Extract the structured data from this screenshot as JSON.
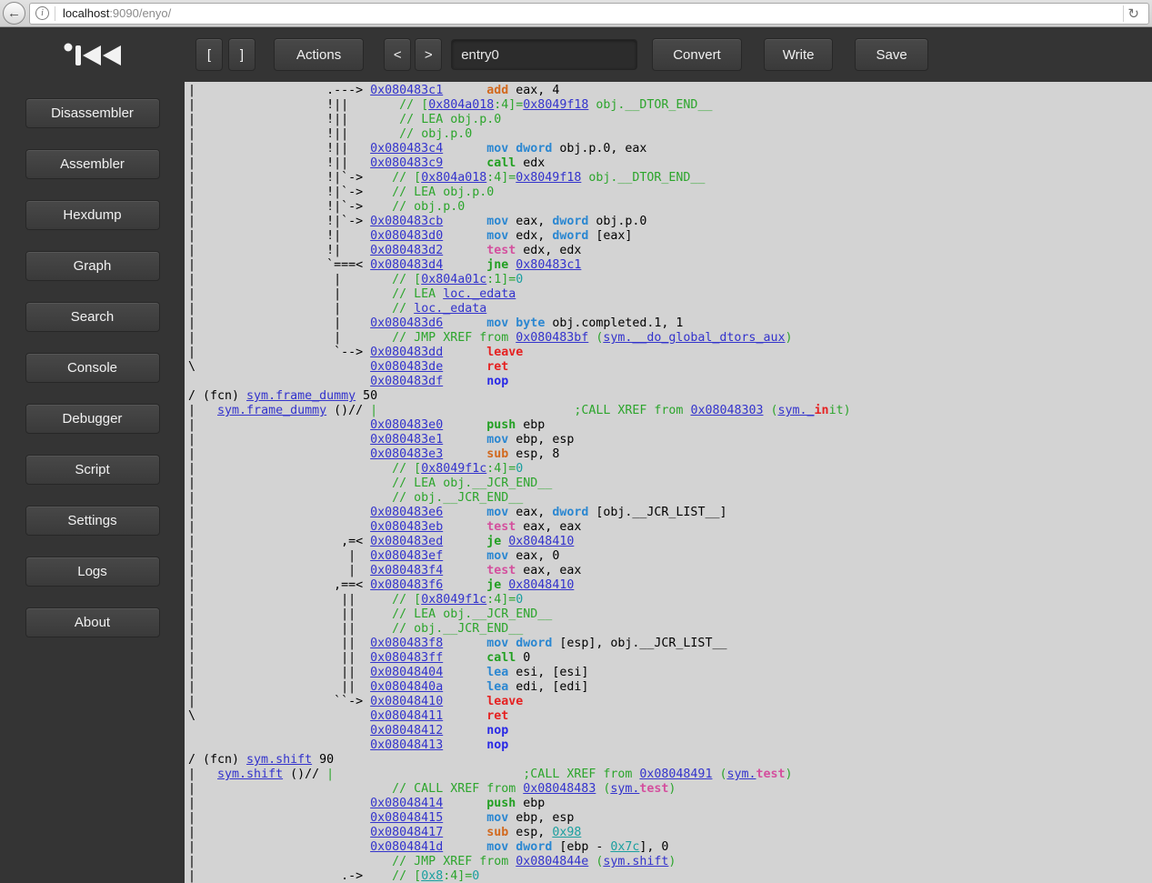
{
  "browser": {
    "back_icon": "←",
    "info_icon": "i",
    "url_host": "localhost",
    "url_rest": ":9090/enyo/",
    "reload_icon": "↻"
  },
  "sidebar": {
    "items": [
      "Disassembler",
      "Assembler",
      "Hexdump",
      "Graph",
      "Search",
      "Console",
      "Debugger",
      "Script",
      "Settings",
      "Logs",
      "About"
    ]
  },
  "toolbar": {
    "bracket_open": "[",
    "bracket_close": "]",
    "actions": "Actions",
    "prev": "<",
    "next": ">",
    "seek_value": "entry0",
    "convert": "Convert",
    "write": "Write",
    "save": "Save"
  },
  "colors": {
    "address_link": "#3333cc",
    "comment": "#2ca52c",
    "opcode_mov": "#2b87d1",
    "opcode_call": "#22a022",
    "opcode_math": "#d2691e",
    "opcode_test": "#d4509e",
    "opcode_ret": "#e52222",
    "opcode_nop": "#2929e6",
    "number": "#1a9f9f",
    "panel_dark": "#343434",
    "content_bg": "#d3d3d3"
  },
  "disasm": {
    "lines": [
      [
        [
          "f",
          "|                  .---> "
        ],
        [
          "a",
          "0x080483c1"
        ],
        [
          "f",
          "      "
        ],
        [
          "ko",
          "add"
        ],
        [
          "f",
          " eax, 4"
        ]
      ],
      [
        [
          "f",
          "|                  !||       "
        ],
        [
          "c",
          "// ["
        ],
        [
          "a",
          "0x804a018"
        ],
        [
          "c",
          ":4]="
        ],
        [
          "a",
          "0x8049f18"
        ],
        [
          "c",
          " obj.__DTOR_END__"
        ]
      ],
      [
        [
          "f",
          "|                  !||       "
        ],
        [
          "c",
          "// LEA obj.p.0"
        ]
      ],
      [
        [
          "f",
          "|                  !||       "
        ],
        [
          "c",
          "// obj.p.0"
        ]
      ],
      [
        [
          "f",
          "|                  !||   "
        ],
        [
          "a",
          "0x080483c4"
        ],
        [
          "f",
          "      "
        ],
        [
          "kb",
          "mov"
        ],
        [
          "f",
          " "
        ],
        [
          "kb",
          "dword"
        ],
        [
          "f",
          " obj.p.0, eax"
        ]
      ],
      [
        [
          "f",
          "|                  !||   "
        ],
        [
          "a",
          "0x080483c9"
        ],
        [
          "f",
          "      "
        ],
        [
          "kg",
          "call"
        ],
        [
          "f",
          " edx"
        ]
      ],
      [
        [
          "f",
          "|                  !|`->    "
        ],
        [
          "c",
          "// ["
        ],
        [
          "a",
          "0x804a018"
        ],
        [
          "c",
          ":4]="
        ],
        [
          "a",
          "0x8049f18"
        ],
        [
          "c",
          " obj.__DTOR_END__"
        ]
      ],
      [
        [
          "f",
          "|                  !|`->    "
        ],
        [
          "c",
          "// LEA obj.p.0"
        ]
      ],
      [
        [
          "f",
          "|                  !|`->    "
        ],
        [
          "c",
          "// obj.p.0"
        ]
      ],
      [
        [
          "f",
          "|                  !|`-> "
        ],
        [
          "a",
          "0x080483cb"
        ],
        [
          "f",
          "      "
        ],
        [
          "kb",
          "mov"
        ],
        [
          "f",
          " eax, "
        ],
        [
          "kb",
          "dword"
        ],
        [
          "f",
          " obj.p.0"
        ]
      ],
      [
        [
          "f",
          "|                  !|    "
        ],
        [
          "a",
          "0x080483d0"
        ],
        [
          "f",
          "      "
        ],
        [
          "kb",
          "mov"
        ],
        [
          "f",
          " edx, "
        ],
        [
          "kb",
          "dword"
        ],
        [
          "f",
          " [eax]"
        ]
      ],
      [
        [
          "f",
          "|                  !|    "
        ],
        [
          "a",
          "0x080483d2"
        ],
        [
          "f",
          "      "
        ],
        [
          "kp",
          "test"
        ],
        [
          "f",
          " edx, edx"
        ]
      ],
      [
        [
          "f",
          "|                  `===< "
        ],
        [
          "a",
          "0x080483d4"
        ],
        [
          "f",
          "      "
        ],
        [
          "kg",
          "jne"
        ],
        [
          "f",
          " "
        ],
        [
          "a",
          "0x80483c1"
        ]
      ],
      [
        [
          "f",
          "|                   |       "
        ],
        [
          "c",
          "// ["
        ],
        [
          "a",
          "0x804a01c"
        ],
        [
          "c",
          ":1]="
        ],
        [
          "t",
          "0"
        ]
      ],
      [
        [
          "f",
          "|                   |       "
        ],
        [
          "c",
          "// LEA "
        ],
        [
          "a",
          "loc._edata"
        ]
      ],
      [
        [
          "f",
          "|                   |       "
        ],
        [
          "c",
          "// "
        ],
        [
          "a",
          "loc._edata"
        ]
      ],
      [
        [
          "f",
          "|                   |    "
        ],
        [
          "a",
          "0x080483d6"
        ],
        [
          "f",
          "      "
        ],
        [
          "kb",
          "mov"
        ],
        [
          "f",
          " "
        ],
        [
          "kb",
          "byte"
        ],
        [
          "f",
          " obj.completed.1, 1"
        ]
      ],
      [
        [
          "f",
          "|                   |       "
        ],
        [
          "c",
          "// JMP XREF from "
        ],
        [
          "a",
          "0x080483bf"
        ],
        [
          "c",
          " ("
        ],
        [
          "a",
          "sym.__do_global_dtors_aux"
        ],
        [
          "c",
          ")"
        ]
      ],
      [
        [
          "f",
          "|                   `--> "
        ],
        [
          "a",
          "0x080483dd"
        ],
        [
          "f",
          "      "
        ],
        [
          "kr",
          "leave"
        ]
      ],
      [
        [
          "f",
          "\\                        "
        ],
        [
          "a",
          "0x080483de"
        ],
        [
          "f",
          "      "
        ],
        [
          "kr",
          "ret"
        ]
      ],
      [
        [
          "f",
          "                         "
        ],
        [
          "a",
          "0x080483df"
        ],
        [
          "f",
          "      "
        ],
        [
          "kn",
          "nop"
        ]
      ],
      [
        [
          "f",
          "/ (fcn) "
        ],
        [
          "a",
          "sym.frame_dummy"
        ],
        [
          "f",
          " 50"
        ]
      ],
      [
        [
          "f",
          "|   "
        ],
        [
          "a",
          "sym.frame_dummy"
        ],
        [
          "f",
          " ()// "
        ],
        [
          "c",
          "|"
        ],
        [
          "f",
          "                           "
        ],
        [
          "c",
          ";CALL XREF from "
        ],
        [
          "a",
          "0x08048303"
        ],
        [
          "c",
          " ("
        ],
        [
          "a",
          "sym._"
        ],
        [
          "hr",
          "in"
        ],
        [
          "c",
          "it)"
        ]
      ],
      [
        [
          "f",
          "|                        "
        ],
        [
          "a",
          "0x080483e0"
        ],
        [
          "f",
          "      "
        ],
        [
          "kg",
          "push"
        ],
        [
          "f",
          " ebp"
        ]
      ],
      [
        [
          "f",
          "|                        "
        ],
        [
          "a",
          "0x080483e1"
        ],
        [
          "f",
          "      "
        ],
        [
          "kb",
          "mov"
        ],
        [
          "f",
          " ebp, esp"
        ]
      ],
      [
        [
          "f",
          "|                        "
        ],
        [
          "a",
          "0x080483e3"
        ],
        [
          "f",
          "      "
        ],
        [
          "ko",
          "sub"
        ],
        [
          "f",
          " esp, 8"
        ]
      ],
      [
        [
          "f",
          "|                           "
        ],
        [
          "c",
          "// ["
        ],
        [
          "a",
          "0x8049f1c"
        ],
        [
          "c",
          ":4]="
        ],
        [
          "t",
          "0"
        ]
      ],
      [
        [
          "f",
          "|                           "
        ],
        [
          "c",
          "// LEA obj.__JCR_END__"
        ]
      ],
      [
        [
          "f",
          "|                           "
        ],
        [
          "c",
          "// obj.__JCR_END__"
        ]
      ],
      [
        [
          "f",
          "|                        "
        ],
        [
          "a",
          "0x080483e6"
        ],
        [
          "f",
          "      "
        ],
        [
          "kb",
          "mov"
        ],
        [
          "f",
          " eax, "
        ],
        [
          "kb",
          "dword"
        ],
        [
          "f",
          " [obj.__JCR_LIST__]"
        ]
      ],
      [
        [
          "f",
          "|                        "
        ],
        [
          "a",
          "0x080483eb"
        ],
        [
          "f",
          "      "
        ],
        [
          "kp",
          "test"
        ],
        [
          "f",
          " eax, eax"
        ]
      ],
      [
        [
          "f",
          "|                    ,=< "
        ],
        [
          "a",
          "0x080483ed"
        ],
        [
          "f",
          "      "
        ],
        [
          "kg",
          "je"
        ],
        [
          "f",
          " "
        ],
        [
          "a",
          "0x8048410"
        ]
      ],
      [
        [
          "f",
          "|                     |  "
        ],
        [
          "a",
          "0x080483ef"
        ],
        [
          "f",
          "      "
        ],
        [
          "kb",
          "mov"
        ],
        [
          "f",
          " eax, 0"
        ]
      ],
      [
        [
          "f",
          "|                     |  "
        ],
        [
          "a",
          "0x080483f4"
        ],
        [
          "f",
          "      "
        ],
        [
          "kp",
          "test"
        ],
        [
          "f",
          " eax, eax"
        ]
      ],
      [
        [
          "f",
          "|                   ,==< "
        ],
        [
          "a",
          "0x080483f6"
        ],
        [
          "f",
          "      "
        ],
        [
          "kg",
          "je"
        ],
        [
          "f",
          " "
        ],
        [
          "a",
          "0x8048410"
        ]
      ],
      [
        [
          "f",
          "|                    ||     "
        ],
        [
          "c",
          "// ["
        ],
        [
          "a",
          "0x8049f1c"
        ],
        [
          "c",
          ":4]="
        ],
        [
          "t",
          "0"
        ]
      ],
      [
        [
          "f",
          "|                    ||     "
        ],
        [
          "c",
          "// LEA obj.__JCR_END__"
        ]
      ],
      [
        [
          "f",
          "|                    ||     "
        ],
        [
          "c",
          "// obj.__JCR_END__"
        ]
      ],
      [
        [
          "f",
          "|                    ||  "
        ],
        [
          "a",
          "0x080483f8"
        ],
        [
          "f",
          "      "
        ],
        [
          "kb",
          "mov"
        ],
        [
          "f",
          " "
        ],
        [
          "kb",
          "dword"
        ],
        [
          "f",
          " [esp], obj.__JCR_LIST__"
        ]
      ],
      [
        [
          "f",
          "|                    ||  "
        ],
        [
          "a",
          "0x080483ff"
        ],
        [
          "f",
          "      "
        ],
        [
          "kg",
          "call"
        ],
        [
          "f",
          " 0"
        ]
      ],
      [
        [
          "f",
          "|                    ||  "
        ],
        [
          "a",
          "0x08048404"
        ],
        [
          "f",
          "      "
        ],
        [
          "kb",
          "lea"
        ],
        [
          "f",
          " esi, [esi]"
        ]
      ],
      [
        [
          "f",
          "|                    ||  "
        ],
        [
          "a",
          "0x0804840a"
        ],
        [
          "f",
          "      "
        ],
        [
          "kb",
          "lea"
        ],
        [
          "f",
          " edi, [edi]"
        ]
      ],
      [
        [
          "f",
          "|                   ``-> "
        ],
        [
          "a",
          "0x08048410"
        ],
        [
          "f",
          "      "
        ],
        [
          "kr",
          "leave"
        ]
      ],
      [
        [
          "f",
          "\\                        "
        ],
        [
          "a",
          "0x08048411"
        ],
        [
          "f",
          "      "
        ],
        [
          "kr",
          "ret"
        ]
      ],
      [
        [
          "f",
          "                         "
        ],
        [
          "a",
          "0x08048412"
        ],
        [
          "f",
          "      "
        ],
        [
          "kn",
          "nop"
        ]
      ],
      [
        [
          "f",
          "                         "
        ],
        [
          "a",
          "0x08048413"
        ],
        [
          "f",
          "      "
        ],
        [
          "kn",
          "nop"
        ]
      ],
      [
        [
          "f",
          "/ (fcn) "
        ],
        [
          "a",
          "sym.shift"
        ],
        [
          "f",
          " 90"
        ]
      ],
      [
        [
          "f",
          "|   "
        ],
        [
          "a",
          "sym.shift"
        ],
        [
          "f",
          " ()// "
        ],
        [
          "c",
          "|"
        ],
        [
          "f",
          "                          "
        ],
        [
          "c",
          ";CALL XREF from "
        ],
        [
          "a",
          "0x08048491"
        ],
        [
          "c",
          " ("
        ],
        [
          "a",
          "sym."
        ],
        [
          "kp",
          "test"
        ],
        [
          "c",
          ")"
        ]
      ],
      [
        [
          "f",
          "|                           "
        ],
        [
          "c",
          "// CALL XREF from "
        ],
        [
          "a",
          "0x08048483"
        ],
        [
          "c",
          " ("
        ],
        [
          "a",
          "sym."
        ],
        [
          "kp",
          "test"
        ],
        [
          "c",
          ")"
        ]
      ],
      [
        [
          "f",
          "|                        "
        ],
        [
          "a",
          "0x08048414"
        ],
        [
          "f",
          "      "
        ],
        [
          "kg",
          "push"
        ],
        [
          "f",
          " ebp"
        ]
      ],
      [
        [
          "f",
          "|                        "
        ],
        [
          "a",
          "0x08048415"
        ],
        [
          "f",
          "      "
        ],
        [
          "kb",
          "mov"
        ],
        [
          "f",
          " ebp, esp"
        ]
      ],
      [
        [
          "f",
          "|                        "
        ],
        [
          "a",
          "0x08048417"
        ],
        [
          "f",
          "      "
        ],
        [
          "ko",
          "sub"
        ],
        [
          "f",
          " esp, "
        ],
        [
          "n",
          "0x98"
        ]
      ],
      [
        [
          "f",
          "|                        "
        ],
        [
          "a",
          "0x0804841d"
        ],
        [
          "f",
          "      "
        ],
        [
          "kb",
          "mov"
        ],
        [
          "f",
          " "
        ],
        [
          "kb",
          "dword"
        ],
        [
          "f",
          " [ebp - "
        ],
        [
          "n",
          "0x7c"
        ],
        [
          "f",
          "], 0"
        ]
      ],
      [
        [
          "f",
          "|                           "
        ],
        [
          "c",
          "// JMP XREF from "
        ],
        [
          "a",
          "0x0804844e"
        ],
        [
          "c",
          " ("
        ],
        [
          "a",
          "sym.shift"
        ],
        [
          "c",
          ")"
        ]
      ],
      [
        [
          "f",
          "|                    .->    "
        ],
        [
          "c",
          "// ["
        ],
        [
          "n",
          "0x8"
        ],
        [
          "c",
          ":4]="
        ],
        [
          "t",
          "0"
        ]
      ]
    ]
  }
}
